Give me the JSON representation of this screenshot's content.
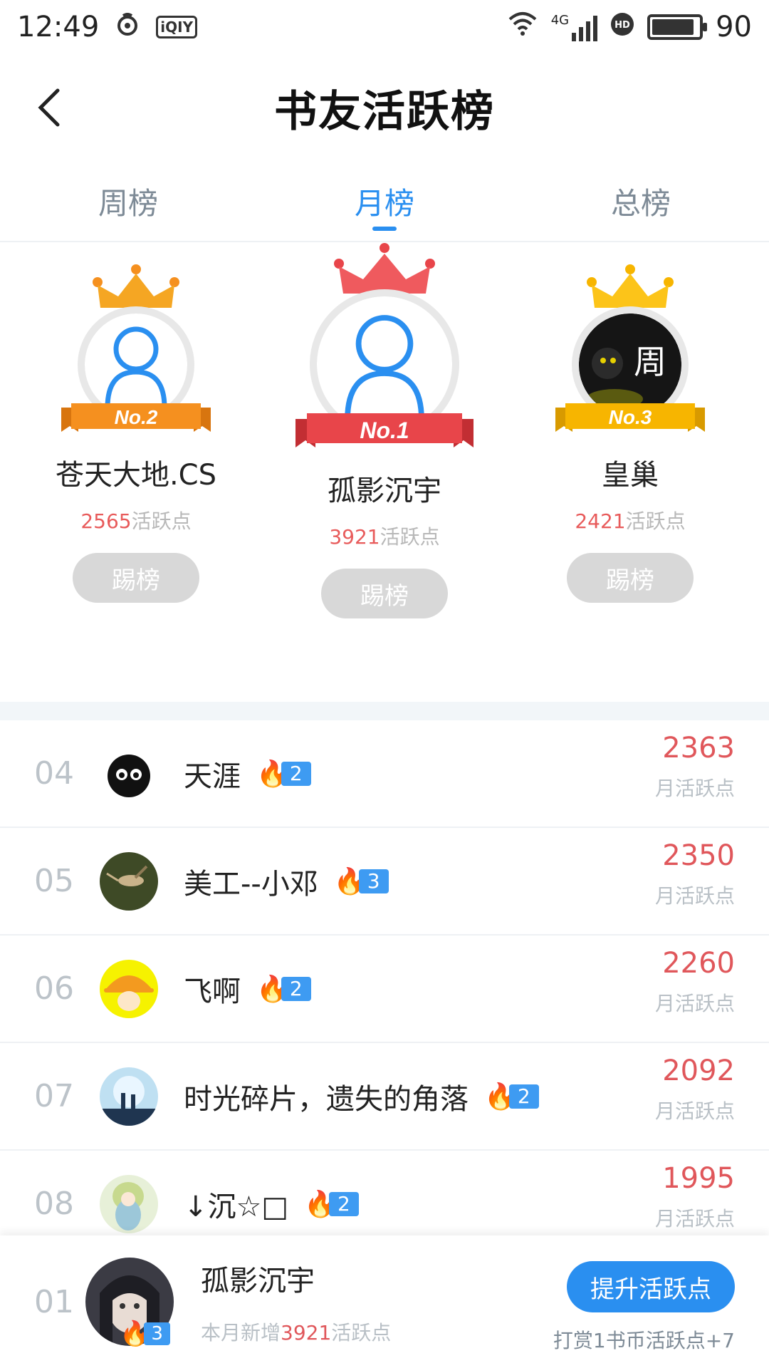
{
  "status_bar": {
    "time": "12:49",
    "app_icons": [
      "netease-icon",
      "iqiyi-icon"
    ],
    "iqiyi_label": "iQIY",
    "network": "4G",
    "battery": "90",
    "battery_level": 0.9
  },
  "header": {
    "title": "书友活跃榜",
    "back_icon": "chevron-left-icon"
  },
  "tabs": [
    {
      "label": "周榜",
      "active": false
    },
    {
      "label": "月榜",
      "active": true
    },
    {
      "label": "总榜",
      "active": false
    }
  ],
  "podium": [
    {
      "rank_label": "No.2",
      "name": "苍天大地.CS",
      "points": "2565",
      "points_unit": "活跃点",
      "button": "踢榜",
      "ribbon_color": "#f5901f",
      "crown_color": "#f5901f"
    },
    {
      "rank_label": "No.1",
      "name": "孤影沉宇",
      "points": "3921",
      "points_unit": "活跃点",
      "button": "踢榜",
      "ribbon_color": "#e8454a",
      "crown_color": "#e8454a"
    },
    {
      "rank_label": "No.3",
      "name": "皇巢",
      "points": "2421",
      "points_unit": "活跃点",
      "button": "踢榜",
      "ribbon_color": "#f7b500",
      "crown_color": "#f7b500",
      "avatar_text": "周"
    }
  ],
  "list": [
    {
      "rank": "04",
      "name": "天涯",
      "level": "2",
      "score": "2363",
      "unit": "月活跃点"
    },
    {
      "rank": "05",
      "name": "美工--小邓",
      "level": "3",
      "score": "2350",
      "unit": "月活跃点"
    },
    {
      "rank": "06",
      "name": "飞啊",
      "level": "2",
      "score": "2260",
      "unit": "月活跃点"
    },
    {
      "rank": "07",
      "name": "时光碎片，遗失的角落",
      "level": "2",
      "score": "2092",
      "unit": "月活跃点"
    },
    {
      "rank": "08",
      "name": "↓沉☆□",
      "level": "2",
      "score": "1995",
      "unit": "月活跃点"
    }
  ],
  "bottom_bar": {
    "rank": "01",
    "name": "孤影沉宇",
    "level": "3",
    "sub_prefix": "本月新增",
    "sub_value": "3921",
    "sub_suffix": "活跃点",
    "button": "提升活跃点",
    "hint": "打赏1书币活跃点+7"
  },
  "colors": {
    "accent": "#2a8ff0",
    "score": "#e0575b",
    "muted": "#b9c0c6"
  }
}
